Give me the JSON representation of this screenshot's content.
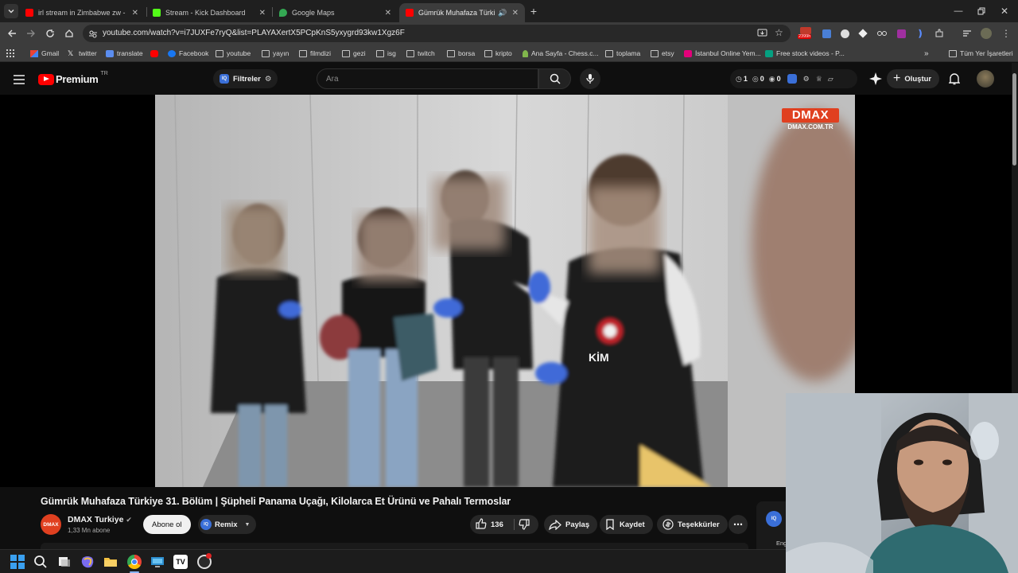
{
  "tabs": [
    {
      "title": "irl stream in Zimbabwe zw - Yo",
      "favicon_color": "#ff0000"
    },
    {
      "title": "Stream - Kick Dashboard",
      "favicon_color": "#53fc18"
    },
    {
      "title": "Google Maps",
      "favicon_color": "#34a853"
    },
    {
      "title": "Gümrük Muhafaza Türkiye",
      "favicon_color": "#ff0000",
      "active": true
    }
  ],
  "toolbar": {
    "url": "youtube.com/watch?v=i7JUXFe7ryQ&list=PLAYAXertX5PCpKnS5yxygrd93kw1Xgz6F",
    "extension_badge": "2399h"
  },
  "bookmarks": [
    {
      "label": "Gmail",
      "icon": "gmail-icon"
    },
    {
      "label": "twitter",
      "icon": "x-icon"
    },
    {
      "label": "translate",
      "icon": "translate-icon"
    },
    {
      "label": "",
      "icon": "youtube-icon"
    },
    {
      "label": "Facebook",
      "icon": "facebook-icon"
    },
    {
      "label": "youtube",
      "icon": "folder-icon"
    },
    {
      "label": "yayın",
      "icon": "folder-icon"
    },
    {
      "label": "filmdizi",
      "icon": "folder-icon"
    },
    {
      "label": "gezi",
      "icon": "folder-icon"
    },
    {
      "label": "isg",
      "icon": "folder-icon"
    },
    {
      "label": "twitch",
      "icon": "folder-icon"
    },
    {
      "label": "borsa",
      "icon": "folder-icon"
    },
    {
      "label": "kripto",
      "icon": "folder-icon"
    },
    {
      "label": "Ana Sayfa - Chess.c...",
      "icon": "chess-icon"
    },
    {
      "label": "toplama",
      "icon": "folder-icon"
    },
    {
      "label": "etsy",
      "icon": "folder-icon"
    },
    {
      "label": "İstanbul Online Yem...",
      "icon": "yemek-icon"
    },
    {
      "label": "Free stock videos - P...",
      "icon": "pexels-icon"
    }
  ],
  "bookmarks_all": "Tüm Yer İşaretleri",
  "masthead": {
    "logo": "Premium",
    "logo_region": "TR",
    "filters_label": "Filtreler",
    "search_placeholder": "Ara",
    "counters": [
      "1",
      "0",
      "0"
    ],
    "create_label": "Oluştur"
  },
  "video": {
    "watermark_main": "DMAX",
    "watermark_sub": "DMAX.COM.TR",
    "vest_text": "KİM"
  },
  "watch": {
    "title": "Gümrük Muhafaza Türkiye 31. Bölüm | Şüpheli Panama Uçağı, Kilolarca Et Ürünü ve Pahalı Termoslar",
    "channel_avatar": "DMAX",
    "channel_name": "DMAX Turkiye",
    "subscribers": "1,33 Mn abone",
    "subscribe_label": "Abone ol",
    "remix_label": "Remix",
    "likes": "136",
    "share_label": "Paylaş",
    "save_label": "Kaydet",
    "thanks_label": "Teşekkürler",
    "side_label": "Eng"
  },
  "colors": {
    "youtube_red": "#ff0000",
    "accent_blue": "#3ea6ff",
    "tab_active": "#3c3c3c"
  }
}
